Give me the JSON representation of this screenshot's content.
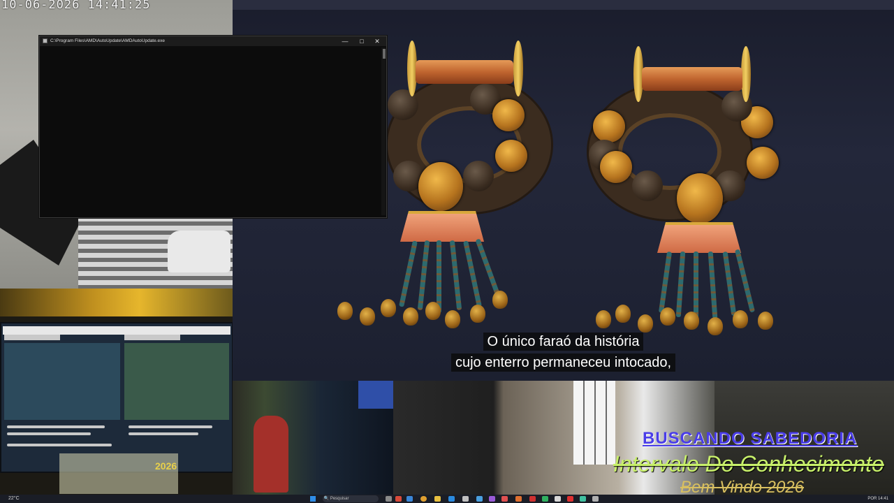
{
  "webcam_top": {
    "timestamp": "10-06-2026 14:41:25"
  },
  "console": {
    "title": "C:\\Program Files\\AMD\\AutoUpdate\\AMDAutoUpdate.exe",
    "minimize": "—",
    "maximize": "□",
    "close": "✕"
  },
  "video": {
    "subtitle_line1": "O único faraó da história",
    "subtitle_line2": "cujo enterro permaneceu intocado,"
  },
  "monitor_cam": {
    "desk_label": "2026"
  },
  "overlay": {
    "line1": "BUSCANDO SABEDORIA",
    "line2": "Intervalo Do Conhecimento",
    "line3": "Bem Vindo 2026"
  },
  "taskbar": {
    "weather": "22°C",
    "search_placeholder": "Pesquisar",
    "tray": "POR  14:41"
  },
  "colors": {
    "accent_overlay1": "#4a3de8",
    "accent_overlay2": "#c8f06a",
    "accent_overlay3": "#d9c060",
    "taskbar_bg": "#1a1d26"
  }
}
